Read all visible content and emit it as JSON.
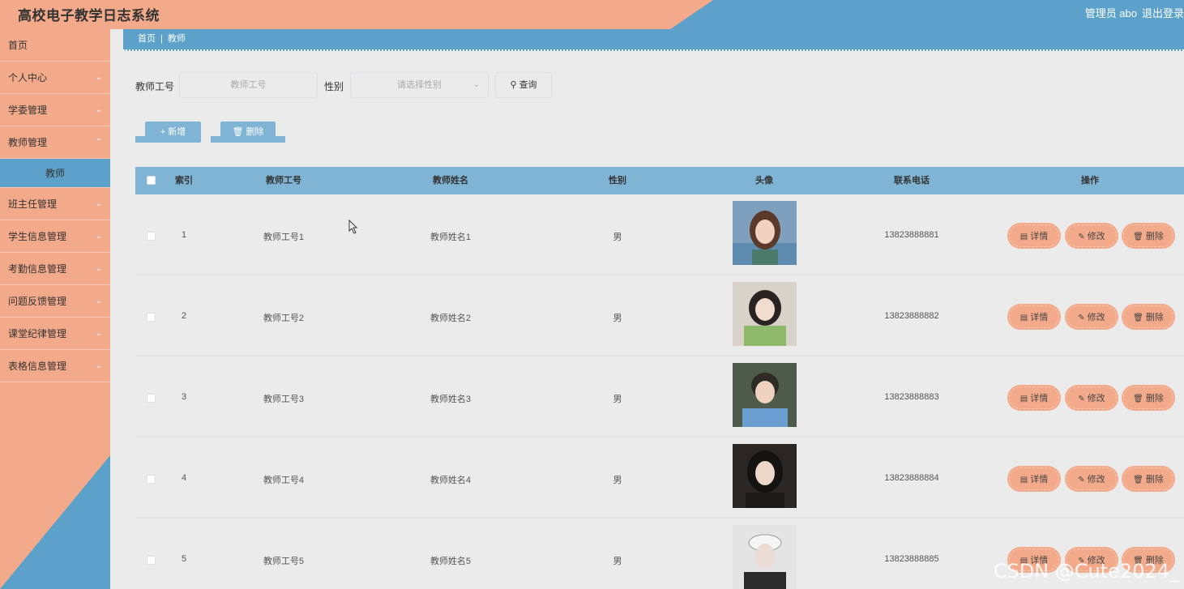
{
  "header": {
    "title": "高校电子教学日志系统",
    "user": "管理员 abo",
    "logout": "退出登录"
  },
  "sidebar": {
    "items": [
      {
        "label": "首页",
        "has_chevron": false
      },
      {
        "label": "个人中心",
        "has_chevron": true
      },
      {
        "label": "学委管理",
        "has_chevron": true
      },
      {
        "label": "教师管理",
        "has_chevron": true
      },
      {
        "label": "教师",
        "sub": true
      },
      {
        "label": "班主任管理",
        "has_chevron": true
      },
      {
        "label": "学生信息管理",
        "has_chevron": true
      },
      {
        "label": "考勤信息管理",
        "has_chevron": true
      },
      {
        "label": "问题反馈管理",
        "has_chevron": true
      },
      {
        "label": "课堂纪律管理",
        "has_chevron": true
      },
      {
        "label": "表格信息管理",
        "has_chevron": true
      }
    ]
  },
  "breadcrumb": {
    "home": "首页",
    "current": "教师"
  },
  "search": {
    "id_label": "教师工号",
    "id_placeholder": "教师工号",
    "gender_label": "性别",
    "gender_placeholder": "请选择性别",
    "query_label": "查询"
  },
  "actions": {
    "add_label": "新增",
    "delete_label": "删除"
  },
  "table": {
    "columns": [
      "索引",
      "教师工号",
      "教师姓名",
      "性别",
      "头像",
      "联系电话",
      "操作"
    ],
    "rows": [
      {
        "index": "1",
        "teacher_id": "教师工号1",
        "name": "教师姓名1",
        "gender": "男",
        "phone": "13823888881"
      },
      {
        "index": "2",
        "teacher_id": "教师工号2",
        "name": "教师姓名2",
        "gender": "男",
        "phone": "13823888882"
      },
      {
        "index": "3",
        "teacher_id": "教师工号3",
        "name": "教师姓名3",
        "gender": "男",
        "phone": "13823888883"
      },
      {
        "index": "4",
        "teacher_id": "教师工号4",
        "name": "教师姓名4",
        "gender": "男",
        "phone": "13823888884"
      },
      {
        "index": "5",
        "teacher_id": "教师工号5",
        "name": "教师姓名5",
        "gender": "男",
        "phone": "13823888885"
      }
    ],
    "row_actions": {
      "detail": "详情",
      "edit": "修改",
      "delete": "删除"
    }
  },
  "watermark": "CSDN @Cute2024_",
  "colors": {
    "peach": "#f3aa8a",
    "blue": "#5ba1c9",
    "light_blue": "#7fb4d4",
    "background": "#ebebeb"
  }
}
